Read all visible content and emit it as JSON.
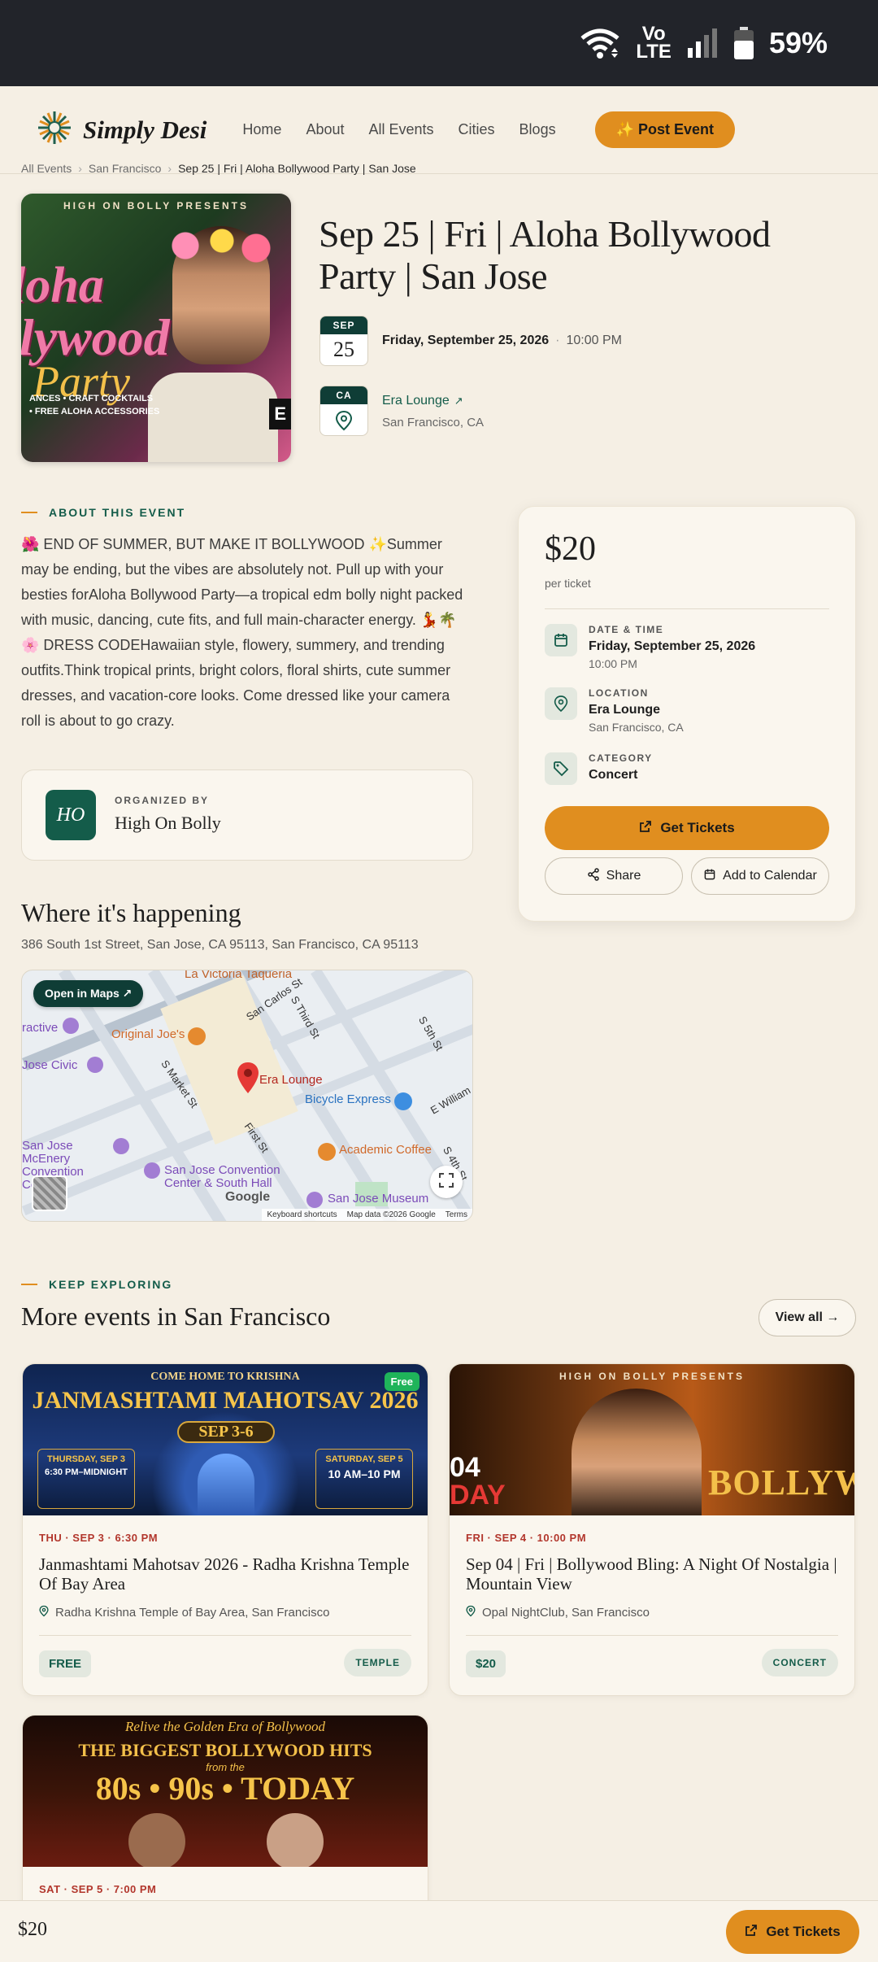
{
  "status_bar": {
    "volte_top": "Vo",
    "volte_bottom": "LTE",
    "battery": "59%"
  },
  "nav": {
    "logo": "Simply Desi",
    "links": [
      "Home",
      "About",
      "All Events",
      "Cities",
      "Blogs"
    ],
    "post_event": "✨ Post Event"
  },
  "breadcrumb": {
    "items": [
      "All Events",
      "San Francisco"
    ],
    "separator": "›",
    "current": "Sep 25 | Fri | Aloha Bollywood Party | San Jose"
  },
  "poster": {
    "top_line": "HIGH ON BOLLY PRESENTS",
    "line1": "loha",
    "line2": "llywood",
    "line3": "Party",
    "line4": "ANCES • CRAFT COCKTAILS",
    "line5": "• FREE ALOHA ACCESSORIES",
    "edge_letter": "E"
  },
  "event": {
    "title": "Sep 25 | Fri | Aloha Bollywood Party | San Jose",
    "month": "SEP",
    "day": "25",
    "date_full": "Friday, September 25, 2026",
    "dot": "·",
    "time": "10:00 PM",
    "state": "CA",
    "venue": "Era Lounge",
    "venue_arrow": "↗",
    "city": "San Francisco, CA"
  },
  "about": {
    "kicker": "ABOUT THIS EVENT",
    "text": "🌺 END OF SUMMER, BUT MAKE IT BOLLYWOOD ✨Summer may be ending, but the vibes are absolutely not. Pull up with your besties forAloha Bollywood Party—a tropical edm bolly night packed with music, dancing, cute fits, and full main-character energy. 💃🌴🌸 DRESS CODEHawaiian style, flowery, summery, and trending outfits.Think tropical prints, bright colors, floral shirts, cute summer dresses, and vacation-core looks. Come dressed like your camera roll is about to go crazy."
  },
  "organizer": {
    "initials": "HO",
    "kicker": "ORGANIZED BY",
    "name": "High On Bolly"
  },
  "ticket": {
    "price": "$20",
    "per": "per ticket",
    "datetime_label": "DATE & TIME",
    "datetime_val": "Friday, September 25, 2026",
    "datetime_sub": "10:00 PM",
    "location_label": "LOCATION",
    "location_val": "Era Lounge",
    "location_sub": "San Francisco, CA",
    "category_label": "CATEGORY",
    "category_val": "Concert",
    "get_tickets": "Get Tickets",
    "share": "Share",
    "add_calendar": "Add to Calendar"
  },
  "where": {
    "title": "Where it's happening",
    "address": "386 South 1st Street, San Jose, CA 95113, San Francisco, CA 95113"
  },
  "map": {
    "open_maps": "Open in Maps ↗",
    "labels": [
      "Original Joe's",
      "Era Lounge",
      "Bicycle Express",
      "Academic Coffee",
      "San Jose Convention Center & South Hall",
      "San Jose McEnery Convention Center",
      "Jose Civic",
      "ractive",
      "San Jose Museum",
      "La Victoria Taqueria",
      "San Carlos St",
      "S Third St",
      "S 5th St",
      "S Market St",
      "First St",
      "E William",
      "S 4th St"
    ],
    "google": "Google",
    "footer": [
      "Keyboard shortcuts",
      "Map data ©2026 Google",
      "Terms"
    ]
  },
  "explore": {
    "kicker": "KEEP EXPLORING",
    "title": "More events in San Francisco",
    "view_all": "View all →",
    "cards": [
      {
        "meta": "THU · SEP 3 · 6:30 PM",
        "title": "Janmashtami Mahotsav 2026 - Radha Krishna Temple Of Bay Area",
        "location": "Radha Krishna Temple of Bay Area, San Francisco",
        "price": "FREE",
        "category": "TEMPLE",
        "badge": "Free",
        "img_top": "COME HOME TO KRISHNA",
        "img_main": "JANMASHTAMI MAHOTSAV 2026",
        "img_sub": "SEP 3-6",
        "img_left": "THURSDAY, SEP 3",
        "img_left_time": "6:30 PM–MIDNIGHT",
        "img_right": "SATURDAY, SEP 5",
        "img_right_time": "10 AM–10 PM"
      },
      {
        "meta": "FRI · SEP 4 · 10:00 PM",
        "title": "Sep 04 | Fri | Bollywood Bling: A Night Of Nostalgia | Mountain View",
        "location": "Opal NightClub, San Francisco",
        "price": "$20",
        "category": "CONCERT",
        "img_top": "HIGH ON BOLLY PRESENTS",
        "img_left": "04",
        "img_left2": "DAY",
        "img_right": "BOLLYWO"
      },
      {
        "meta": "SAT · SEP 5 · 7:00 PM",
        "img_top": "Relive the Golden Era of Bollywood",
        "img_main": "THE BIGGEST BOLLYWOOD HITS",
        "img_from": "from the",
        "img_decades": "80s • 90s • TODAY"
      }
    ]
  },
  "bottom_bar": {
    "price": "$20",
    "button": "Get Tickets"
  },
  "colors": {
    "accent": "#e08e1f",
    "brand_green": "#145c4a",
    "background": "#f5efe4"
  }
}
